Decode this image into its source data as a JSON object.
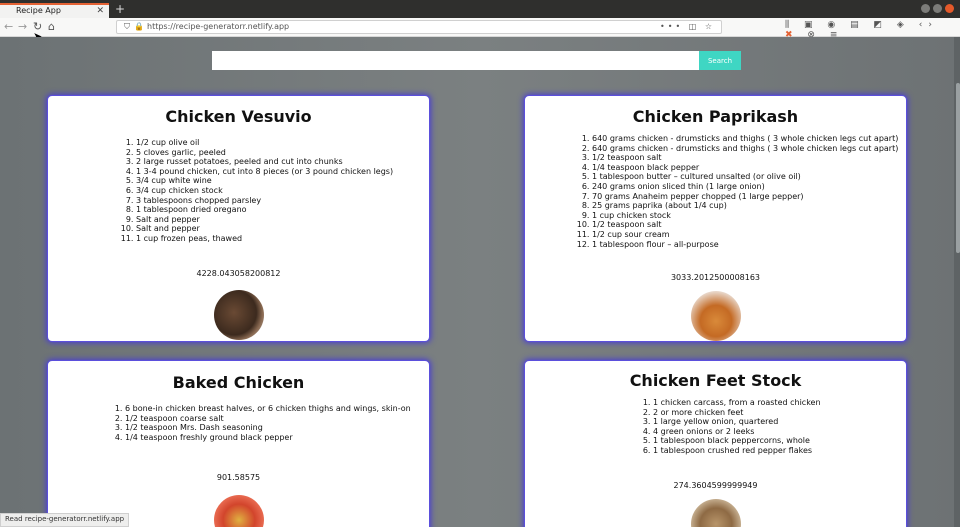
{
  "browser": {
    "tab_title": "Recipe App",
    "tab_close": "✕",
    "new_tab": "+",
    "url": "https://recipe-generatorr.netlify.app",
    "status_text": "Read recipe-generatorr.netlify.app",
    "nav_icons": [
      "back-icon",
      "forward-icon",
      "reload-icon",
      "home-icon"
    ],
    "url_icons": [
      "shield-icon",
      "lock-icon"
    ],
    "url_actions": [
      "more-icon",
      "pocket-icon",
      "star-icon"
    ],
    "toolbar_icons": [
      "library-icon",
      "sidebar-icon",
      "account-icon",
      "extension-icon",
      "screenshot-icon",
      "devtools-icon",
      "tools-icon",
      "extension2-icon",
      "extension3-icon",
      "menu-icon"
    ]
  },
  "search": {
    "placeholder": "",
    "button_label": "Search",
    "accent_color": "#3fd6c3"
  },
  "recipes": [
    {
      "title": "Chicken Vesuvio",
      "ingredients": [
        "1/2 cup olive oil",
        "5 cloves garlic, peeled",
        "2 large russet potatoes, peeled and cut into chunks",
        "1 3-4 pound chicken, cut into 8 pieces (or 3 pound chicken legs)",
        "3/4 cup white wine",
        "3/4 cup chicken stock",
        "3 tablespoons chopped parsley",
        "1 tablespoon dried oregano",
        "Salt and pepper",
        "Salt and pepper",
        "1 cup frozen peas, thawed"
      ],
      "calories": "4228.043058200812"
    },
    {
      "title": "Chicken Paprikash",
      "ingredients": [
        "640 grams chicken - drumsticks and thighs ( 3 whole chicken legs cut apart)",
        "640 grams chicken - drumsticks and thighs ( 3 whole chicken legs cut apart)",
        "1/2 teaspoon salt",
        "1/4 teaspoon black pepper",
        "1 tablespoon butter – cultured unsalted (or olive oil)",
        "240 grams onion sliced thin (1 large onion)",
        "70 grams Anaheim pepper chopped (1 large pepper)",
        "25 grams paprika (about 1/4 cup)",
        "1 cup chicken stock",
        "1/2 teaspoon salt",
        "1/2 cup sour cream",
        "1 tablespoon flour – all-purpose"
      ],
      "calories": "3033.2012500008163"
    },
    {
      "title": "Baked Chicken",
      "ingredients": [
        "6 bone-in chicken breast halves, or 6 chicken thighs and wings, skin-on",
        "1/2 teaspoon coarse salt",
        "1/2 teaspoon Mrs. Dash seasoning",
        "1/4 teaspoon freshly ground black pepper"
      ],
      "calories": "901.58575"
    },
    {
      "title": "Chicken Feet Stock",
      "ingredients": [
        "1 chicken carcass, from a roasted chicken",
        "2 or more chicken feet",
        "1 large yellow onion, quartered",
        "4 green onions or 2 leeks",
        "1 tablespoon black peppercorns, whole",
        "1 tablespoon crushed red pepper flakes"
      ],
      "calories": "274.3604599999949"
    }
  ]
}
